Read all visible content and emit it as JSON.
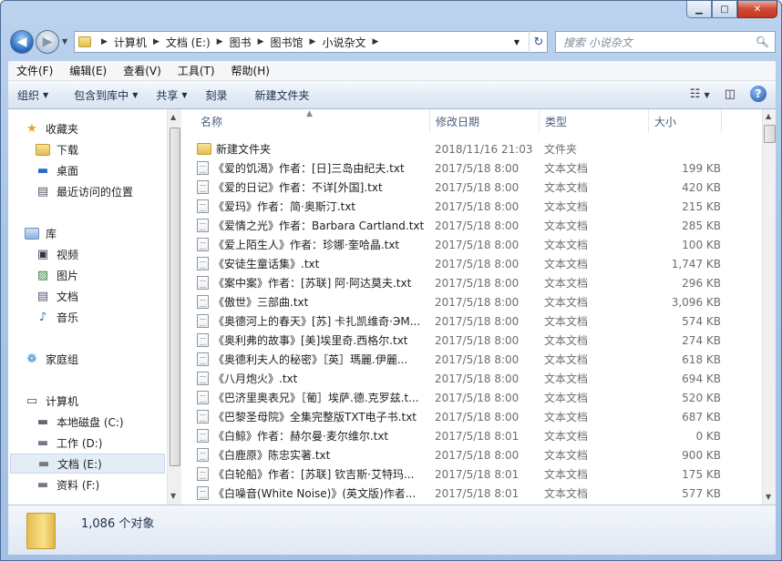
{
  "window": {
    "minimize": "▁",
    "maximize": "□",
    "close": "✕"
  },
  "nav": {
    "back": "◀",
    "forward": "▶"
  },
  "address": {
    "crumbs": [
      "计算机",
      "文档 (E:)",
      "图书",
      "图书馆",
      "小说杂文"
    ]
  },
  "search": {
    "placeholder": "搜索 小说杂文"
  },
  "menu": [
    "文件(F)",
    "编辑(E)",
    "查看(V)",
    "工具(T)",
    "帮助(H)"
  ],
  "toolbar": {
    "organize": "组织",
    "include": "包含到库中",
    "share": "共享",
    "burn": "刻录",
    "new_folder": "新建文件夹"
  },
  "sidebar": {
    "favorites": "收藏夹",
    "downloads": "下载",
    "desktop": "桌面",
    "recent": "最近访问的位置",
    "libraries": "库",
    "videos": "视频",
    "pictures": "图片",
    "documents": "文档",
    "music": "音乐",
    "homegroup": "家庭组",
    "computer": "计算机",
    "drive_c": "本地磁盘 (C:)",
    "drive_d": "工作 (D:)",
    "drive_e": "文档 (E:)",
    "drive_f": "资料 (F:)"
  },
  "columns": {
    "name": "名称",
    "date": "修改日期",
    "type": "类型",
    "size": "大小"
  },
  "files": [
    {
      "name": "新建文件夹",
      "date": "2018/11/16 21:03",
      "type": "文件夹",
      "size": ""
    },
    {
      "name": "《爱的饥渴》作者：[日]三岛由纪夫.txt",
      "date": "2017/5/18 8:00",
      "type": "文本文档",
      "size": "199 KB"
    },
    {
      "name": "《爱的日记》作者：不详[外国].txt",
      "date": "2017/5/18 8:00",
      "type": "文本文档",
      "size": "420 KB"
    },
    {
      "name": "《爱玛》作者：简·奥斯汀.txt",
      "date": "2017/5/18 8:00",
      "type": "文本文档",
      "size": "215 KB"
    },
    {
      "name": "《爱情之光》作者：Barbara Cartland.txt",
      "date": "2017/5/18 8:00",
      "type": "文本文档",
      "size": "285 KB"
    },
    {
      "name": "《爱上陌生人》作者：珍娜·奎哈晶.txt",
      "date": "2017/5/18 8:00",
      "type": "文本文档",
      "size": "100 KB"
    },
    {
      "name": "《安徒生童话集》.txt",
      "date": "2017/5/18 8:00",
      "type": "文本文档",
      "size": "1,747 KB"
    },
    {
      "name": "《案中案》作者：[苏联] 阿·阿达莫夫.txt",
      "date": "2017/5/18 8:00",
      "type": "文本文档",
      "size": "296 KB"
    },
    {
      "name": "《傲世》三部曲.txt",
      "date": "2017/5/18 8:00",
      "type": "文本文档",
      "size": "3,096 KB"
    },
    {
      "name": "《奥德河上的春天》[苏] 卡扎凯维奇·ЭМ...",
      "date": "2017/5/18 8:00",
      "type": "文本文档",
      "size": "574 KB"
    },
    {
      "name": "《奥利弗的故事》[美]埃里奇.西格尔.txt",
      "date": "2017/5/18 8:00",
      "type": "文本文档",
      "size": "274 KB"
    },
    {
      "name": "《奥德利夫人的秘密》［英］瑪麗.伊麗...",
      "date": "2017/5/18 8:00",
      "type": "文本文档",
      "size": "618 KB"
    },
    {
      "name": "《八月炮火》.txt",
      "date": "2017/5/18 8:00",
      "type": "文本文档",
      "size": "694 KB"
    },
    {
      "name": "《巴济里奥表兄》［葡］埃萨.德.克罗兹.t...",
      "date": "2017/5/18 8:00",
      "type": "文本文档",
      "size": "520 KB"
    },
    {
      "name": "《巴黎圣母院》全集完整版TXT电子书.txt",
      "date": "2017/5/18 8:00",
      "type": "文本文档",
      "size": "687 KB"
    },
    {
      "name": "《白鲸》作者：赫尔曼·麦尔维尔.txt",
      "date": "2017/5/18 8:01",
      "type": "文本文档",
      "size": "0 KB"
    },
    {
      "name": "《白鹿原》陈忠实著.txt",
      "date": "2017/5/18 8:00",
      "type": "文本文档",
      "size": "900 KB"
    },
    {
      "name": "《白轮船》作者：[苏联] 钦吉斯·艾特玛...",
      "date": "2017/5/18 8:01",
      "type": "文本文档",
      "size": "175 KB"
    },
    {
      "name": "《白噪音(White Noise)》(英文版)作者...",
      "date": "2017/5/18 8:01",
      "type": "文本文档",
      "size": "577 KB"
    }
  ],
  "status": {
    "count": "1,086 个对象"
  }
}
